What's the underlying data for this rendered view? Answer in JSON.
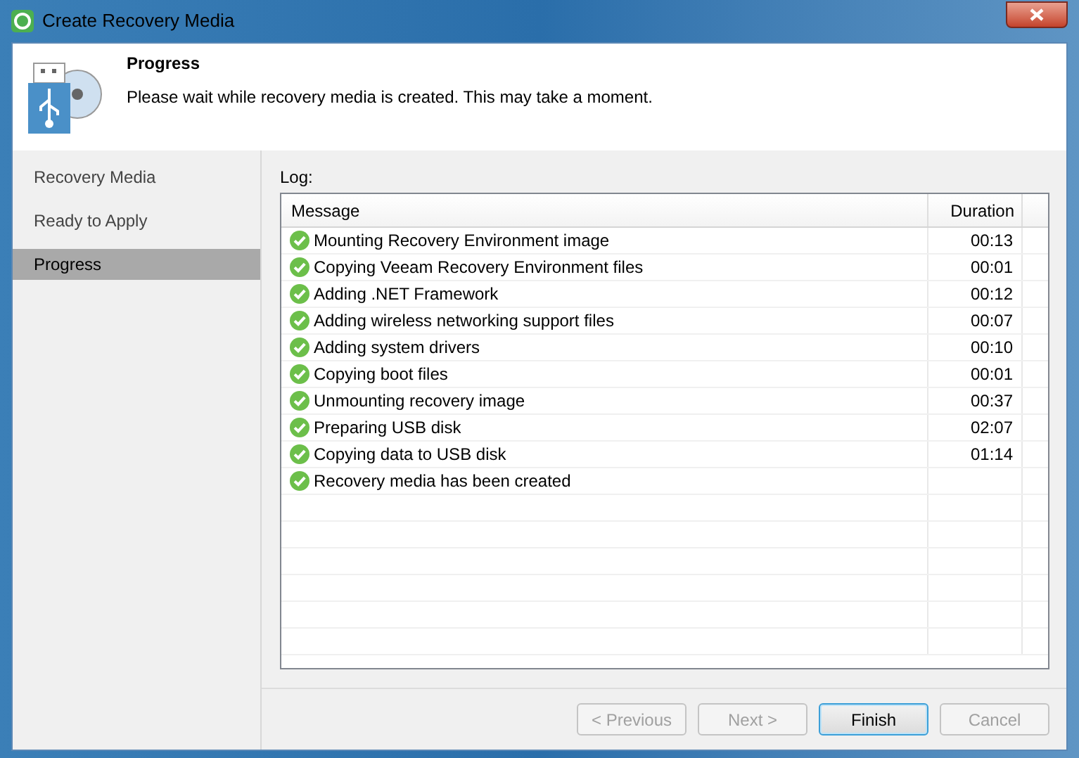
{
  "window": {
    "title": "Create Recovery Media"
  },
  "header": {
    "title": "Progress",
    "description": "Please wait while recovery media is created. This may take a moment."
  },
  "sidebar": {
    "items": [
      {
        "label": "Recovery Media",
        "selected": false
      },
      {
        "label": "Ready to Apply",
        "selected": false
      },
      {
        "label": "Progress",
        "selected": true
      }
    ]
  },
  "log": {
    "label": "Log:",
    "columns": [
      "Message",
      "Duration"
    ],
    "rows": [
      {
        "message": "Mounting Recovery Environment image",
        "duration": "00:13"
      },
      {
        "message": "Copying Veeam Recovery Environment files",
        "duration": "00:01"
      },
      {
        "message": "Adding .NET Framework",
        "duration": "00:12"
      },
      {
        "message": "Adding wireless networking support files",
        "duration": "00:07"
      },
      {
        "message": "Adding system drivers",
        "duration": "00:10"
      },
      {
        "message": "Copying boot files",
        "duration": "00:01"
      },
      {
        "message": "Unmounting recovery image",
        "duration": "00:37"
      },
      {
        "message": "Preparing USB disk",
        "duration": "02:07"
      },
      {
        "message": "Copying data to USB disk",
        "duration": "01:14"
      },
      {
        "message": "Recovery media has been created"
      }
    ]
  },
  "buttons": [
    {
      "label": "< Previous",
      "disabled": true,
      "default": false
    },
    {
      "label": "Next >",
      "disabled": true,
      "default": false
    },
    {
      "label": "Finish",
      "disabled": false,
      "default": true
    },
    {
      "label": "Cancel",
      "disabled": true,
      "default": false
    }
  ]
}
